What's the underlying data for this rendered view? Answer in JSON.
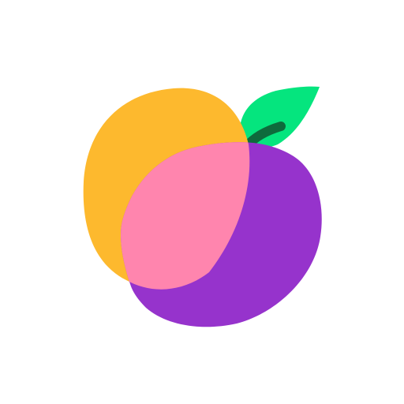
{
  "logo": {
    "icon": "fruit-logo-icon",
    "colors": {
      "background": "#ffffff",
      "orange_fruit": "#FDB92E",
      "purple_fruit": "#9633CC",
      "overlap": "#FF85AE",
      "leaf": "#05E57E",
      "stem": "#0E6B3C"
    }
  }
}
